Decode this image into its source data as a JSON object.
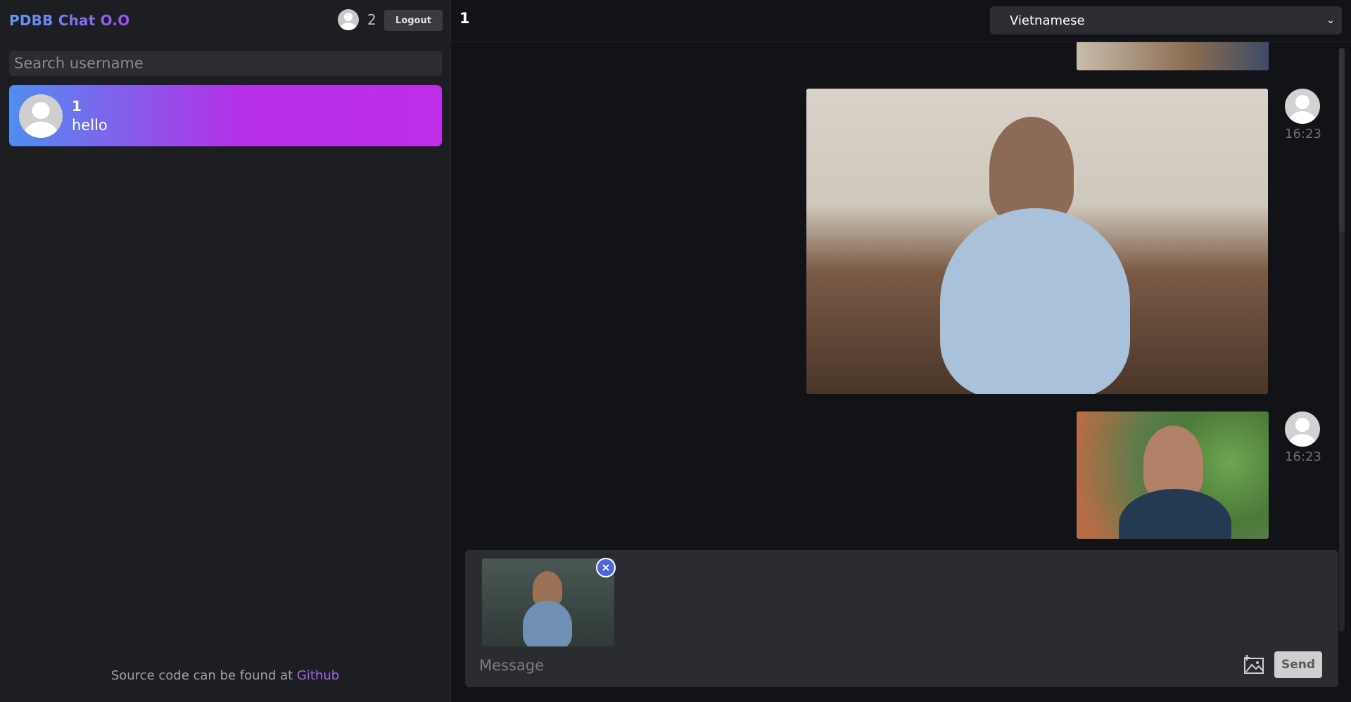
{
  "sidebar": {
    "brand": "PDBB Chat O.O",
    "current_user": "2",
    "logout_label": "Logout",
    "search_placeholder": "Search username",
    "conversations": [
      {
        "name": "1",
        "last_message": "hello"
      }
    ],
    "footer_text": "Source code can be found at ",
    "footer_link": "Github"
  },
  "chat": {
    "title": "1",
    "language": "Vietnamese",
    "messages": [
      {
        "type": "image",
        "time": ""
      },
      {
        "type": "image",
        "time": "16:23"
      },
      {
        "type": "image",
        "time": "16:23"
      }
    ]
  },
  "composer": {
    "placeholder": "Message",
    "send_label": "Send",
    "attachment_remove": "×"
  },
  "colors": {
    "accent_gradient_start": "#5b9df5",
    "accent_gradient_end": "#bf2de8",
    "link": "#a464e8",
    "remove_badge": "#4f63dd"
  },
  "icons": {
    "avatar": "user-avatar-icon",
    "image_attach": "image-upload-icon",
    "remove": "close-circle-icon",
    "dropdown": "chevron-down-icon"
  }
}
